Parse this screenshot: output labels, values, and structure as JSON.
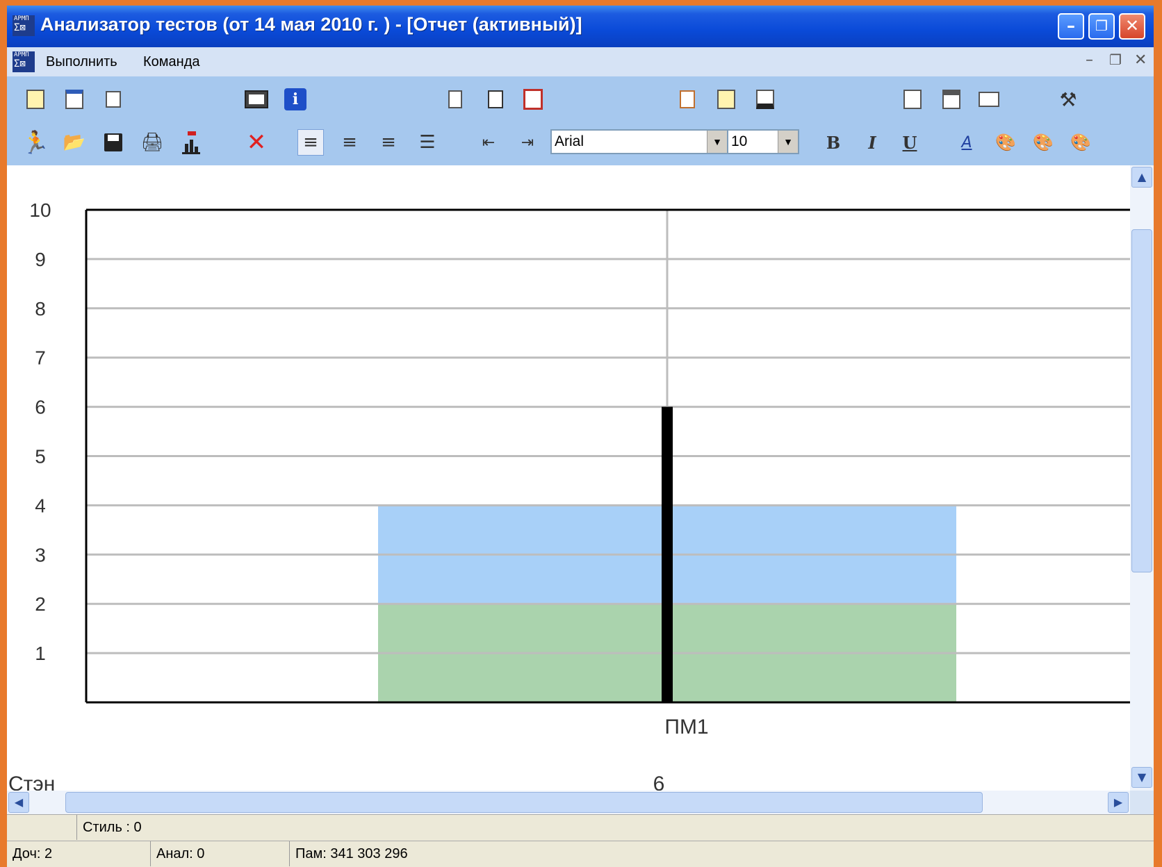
{
  "window": {
    "title": "Анализатор тестов  (от 14 мая 2010 г. ) - [Отчет (активный)]",
    "app_badge_top": "АРМП",
    "app_badge_bottom": "Σ⊠"
  },
  "menu": {
    "items": [
      "Выполнить",
      "Команда"
    ]
  },
  "toolbar": {
    "font_name": "Arial",
    "font_size": "10",
    "bold_label": "B",
    "italic_label": "I",
    "underline_label": "U"
  },
  "chart_data": {
    "type": "bar",
    "categories": [
      "ПМ1"
    ],
    "ylim": [
      0,
      10
    ],
    "y_ticks": [
      "1",
      "2",
      "3",
      "4",
      "5",
      "6",
      "7",
      "8",
      "9",
      "10"
    ],
    "bands": [
      {
        "from": 0,
        "to": 2,
        "color": "#AAD3AD"
      },
      {
        "from": 2,
        "to": 4,
        "color": "#A8D0F8"
      }
    ],
    "values": [
      6
    ],
    "row_label": "Стэн",
    "row_values": [
      "6"
    ],
    "grid": true
  },
  "status": {
    "style": "Стиль : 0",
    "doc": "Доч: 2",
    "anal": "Анал: 0",
    "mem": "Пам: 341 303 296"
  }
}
